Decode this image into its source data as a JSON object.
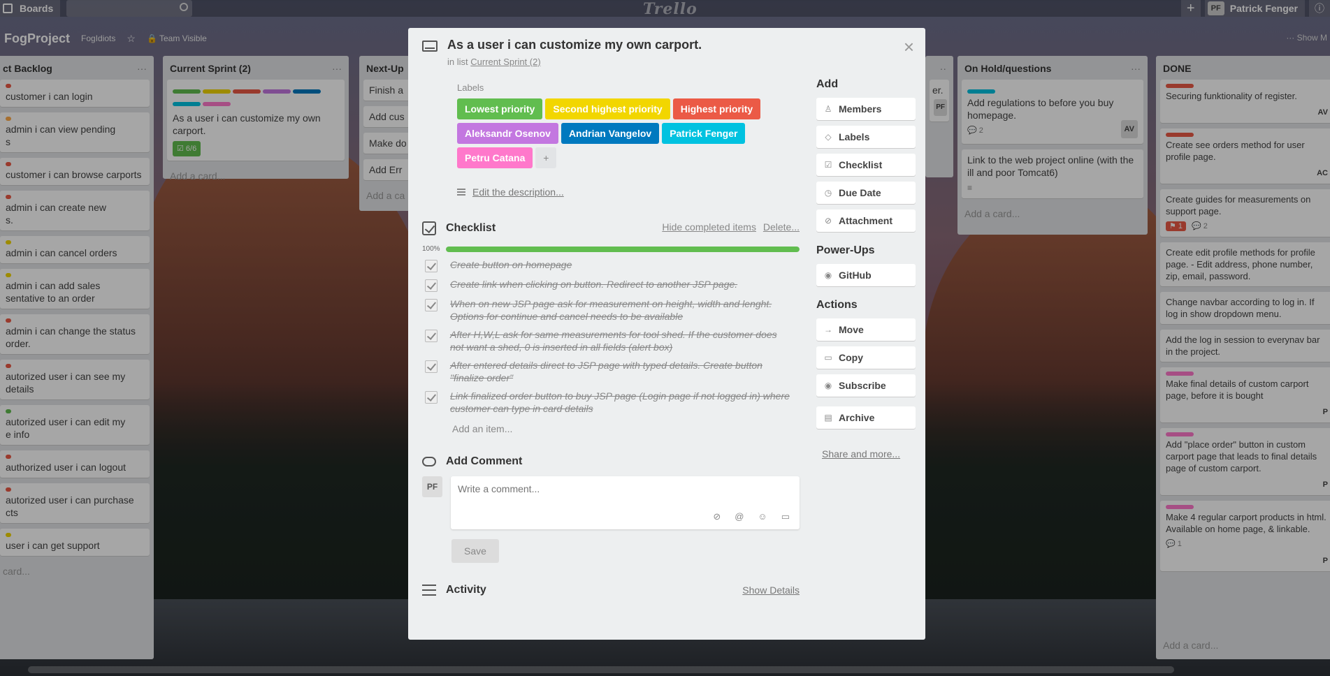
{
  "colors": {
    "green": "#61bd4f",
    "yellow": "#f2d600",
    "orange": "#ffab4a",
    "red": "#eb5a46",
    "purple": "#c377e0",
    "blue": "#0079bf",
    "sky": "#00c2e0",
    "pink": "#ff78cb"
  },
  "topbar": {
    "boards_label": "Boards",
    "logo": "Trello",
    "member_initials": "PF",
    "member_name": "Patrick Fenger",
    "add_icon": "plus-icon",
    "info_icon": "info-icon"
  },
  "board": {
    "title": "FogProject",
    "team": "FogIdiots",
    "visibility": "Team Visible",
    "show_menu": "Show M"
  },
  "lists": {
    "backlog": {
      "title": "ct Backlog",
      "cards": [
        {
          "text": "customer i can login",
          "label": "red"
        },
        {
          "text": "admin i can view pending\ns",
          "label": "orange"
        },
        {
          "text": "customer i can browse carports",
          "label": "red"
        },
        {
          "text": "admin i can create new\ns.",
          "label": "red"
        },
        {
          "text": "admin i can cancel orders",
          "label": "yellow"
        },
        {
          "text": "admin i can add sales\nsentative to an order",
          "label": "yellow"
        },
        {
          "text": "admin i can change the status\norder.",
          "label": "red"
        },
        {
          "text": "autorized user i can see my\ndetails",
          "label": "red"
        },
        {
          "text": "autorized user i can edit my\ne info",
          "label": "green"
        },
        {
          "text": "authorized user i can logout",
          "label": "red"
        },
        {
          "text": "autorized user i can purchase\ncts",
          "label": "red"
        },
        {
          "text": "user i can get support",
          "label": "yellow"
        }
      ],
      "add_card": "card..."
    },
    "sprint": {
      "title": "Current Sprint (2)",
      "card_text": "As a user i can customize my own carport.",
      "badge": "6/6",
      "add_card": "Add a card..."
    },
    "nextup": {
      "title": "Next-Up",
      "cards": [
        "Finish a",
        "Add cus",
        "Make do",
        "Add Err"
      ],
      "add_card": "Add a ca"
    },
    "onhold": {
      "title": "On Hold/questions",
      "card1": "Add regulations to before you buy homepage.",
      "card1_comments": "2",
      "card1_member": "AV",
      "card2": "Link to the web project online (with the ill and poor Tomcat6)",
      "add_card": "Add a card...",
      "partial_card": "er.",
      "partial_member": "PF"
    },
    "done": {
      "title": "DONE",
      "cards": [
        {
          "text": "Securing funktionality of register.",
          "label": "red",
          "member": "AV"
        },
        {
          "text": "Create see orders method for user profile page.",
          "label": "red",
          "member": "AC"
        },
        {
          "text": "Create guides for measurements on support page.",
          "label": "",
          "member": ""
        },
        {
          "text": "Create edit profile methods for profile page. - Edit address, phone number, zip, email, password.",
          "label": "",
          "member": ""
        },
        {
          "text": "Change navbar according to log in. If log in show dropdown menu.",
          "label": "",
          "member": ""
        },
        {
          "text": "Add the log in session to everynav bar in the project.",
          "label": "",
          "member": ""
        },
        {
          "text": "Make final details of custom carport page, before it is bought",
          "label": "pink",
          "member": "P"
        },
        {
          "text": "Add \"place order\" button in custom carport page that leads to final details page of custom carport.",
          "label": "pink",
          "member": "P"
        },
        {
          "text": "Make 4 regular carport products in html. Available on home page, & linkable.",
          "label": "pink",
          "member": "P"
        }
      ],
      "badge_alert": "1",
      "badge_comments": "2",
      "last_comments": "1",
      "add_card": "Add a card..."
    }
  },
  "modal": {
    "title": "As a user i can customize my own carport.",
    "in_list_prefix": "in list",
    "in_list_name": "Current Sprint (2)",
    "labels_heading": "Labels",
    "labels": [
      {
        "name": "Lowest priority",
        "color": "#61bd4f"
      },
      {
        "name": "Second highest priority",
        "color": "#f2d600"
      },
      {
        "name": "Highest priority",
        "color": "#eb5a46"
      },
      {
        "name": "Aleksandr Osenov",
        "color": "#c377e0"
      },
      {
        "name": "Andrian Vangelov",
        "color": "#0079bf"
      },
      {
        "name": "Patrick Fenger",
        "color": "#00c2e0"
      },
      {
        "name": "Petru Catana",
        "color": "#ff78cb"
      }
    ],
    "label_add": "+",
    "edit_description": "Edit the description...",
    "checklist": {
      "title": "Checklist",
      "hide_completed": "Hide completed items",
      "delete": "Delete...",
      "progress_percent": 100,
      "progress_label": "100%",
      "items": [
        "Create button on homepage",
        "Create link when clicking on button. Redirect to another JSP page.",
        "When on new JSP page ask for measurement on height, width and lenght. Options for continue and cancel needs to be available",
        "After H,W,L ask for same measurements for tool shed. If the customer does not want a shed, 0 is inserted in all fields (alert box)",
        "After entered details direct to JSP page with typed details. Create button \"finalize order\"",
        "Link finalized order button to buy JSP page (Login page if not logged in) where customer can type in card details"
      ],
      "add_item": "Add an item..."
    },
    "comment": {
      "title": "Add Comment",
      "avatar": "PF",
      "placeholder": "Write a comment...",
      "save": "Save"
    },
    "activity": {
      "title": "Activity",
      "show_details": "Show Details"
    },
    "sidebar": {
      "add_heading": "Add",
      "add_buttons": [
        {
          "label": "Members",
          "icon": "person-icon"
        },
        {
          "label": "Labels",
          "icon": "tag-icon"
        },
        {
          "label": "Checklist",
          "icon": "checkbox-icon"
        },
        {
          "label": "Due Date",
          "icon": "clock-icon"
        },
        {
          "label": "Attachment",
          "icon": "paperclip-icon"
        }
      ],
      "powerups_heading": "Power-Ups",
      "github": "GitHub",
      "actions_heading": "Actions",
      "actions": [
        {
          "label": "Move",
          "icon": "arrow-right-icon"
        },
        {
          "label": "Copy",
          "icon": "card-icon"
        },
        {
          "label": "Subscribe",
          "icon": "eye-icon"
        },
        {
          "label": "Archive",
          "icon": "archive-icon"
        }
      ],
      "share": "Share and more..."
    }
  }
}
